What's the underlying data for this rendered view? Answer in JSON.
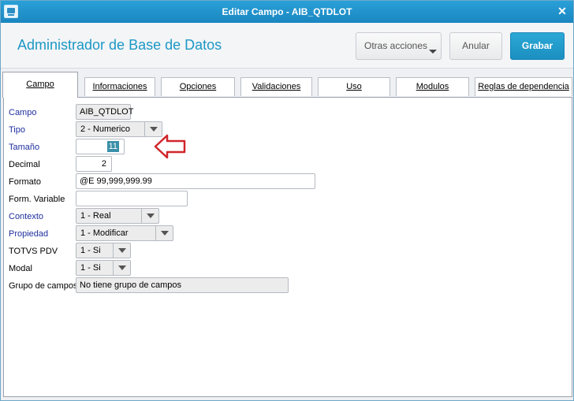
{
  "window": {
    "title": "Editar Campo - AIB_QTDLOT"
  },
  "header": {
    "app_title": "Administrador de Base de Datos",
    "buttons": {
      "otras": "Otras acciones",
      "anular": "Anular",
      "grabar": "Grabar"
    }
  },
  "tabs": [
    "Campo",
    "Informaciones",
    "Opciones",
    "Validaciones",
    "Uso",
    "Modulos",
    "Reglas de dependencia"
  ],
  "form": {
    "campo": {
      "label": "Campo",
      "value": "AIB_QTDLOT"
    },
    "tipo": {
      "label": "Tipo",
      "value": "2 - Numerico"
    },
    "tamano": {
      "label": "Tamaño",
      "value": "11"
    },
    "decimal": {
      "label": "Decimal",
      "value": "2"
    },
    "formato": {
      "label": "Formato",
      "value": "@E 99,999,999.99"
    },
    "form_variable": {
      "label": "Form. Variable",
      "value": ""
    },
    "contexto": {
      "label": "Contexto",
      "value": "1 - Real"
    },
    "propiedad": {
      "label": "Propiedad",
      "value": "1 - Modificar"
    },
    "totvs_pdv": {
      "label": "TOTVS PDV",
      "value": "1 - Si"
    },
    "modal": {
      "label": "Modal",
      "value": "1 - Si"
    },
    "grupo": {
      "label": "Grupo de campos",
      "value": "No tiene grupo de campos"
    }
  },
  "colors": {
    "accent": "#1c98c5",
    "required_label": "#1f2f9f",
    "arrow": "#d0262b"
  },
  "icons": {
    "app": "window-app-icon",
    "close": "close-icon",
    "annotation": "red-arrow-left-icon"
  }
}
